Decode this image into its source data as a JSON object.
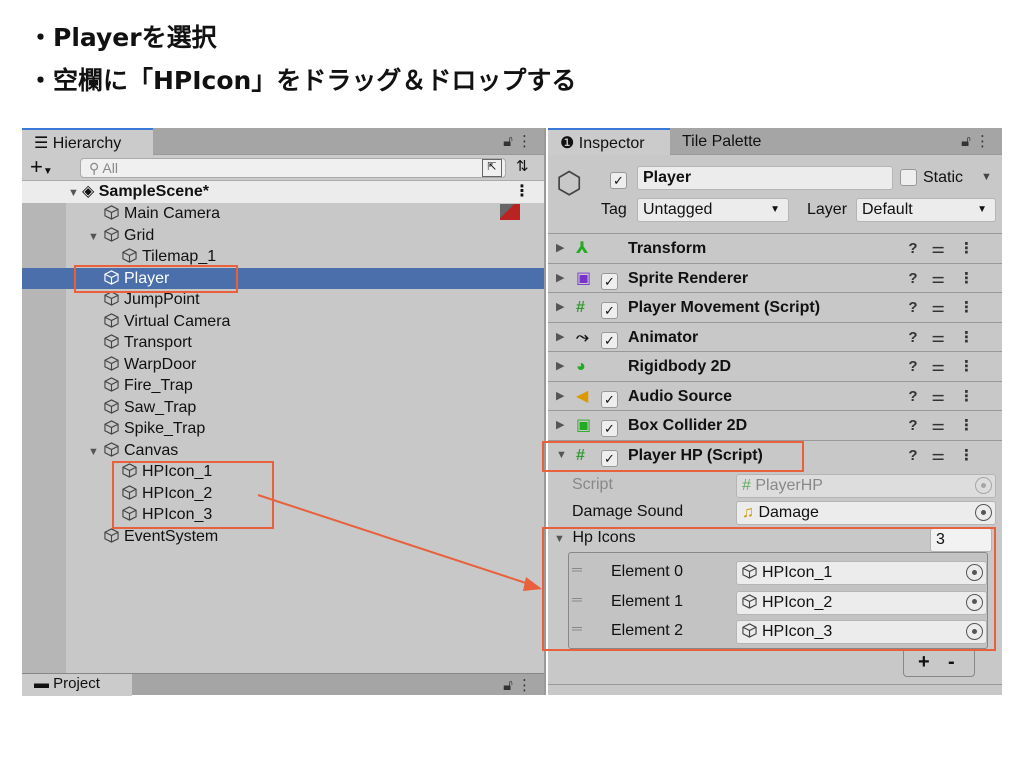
{
  "instructions": [
    "・Playerを選択",
    "・空欄に「HPIcon」をドラッグ＆ドロップする"
  ],
  "hierarchy": {
    "tab": "Hierarchy",
    "search_placeholder": "All",
    "scene": "SampleScene*",
    "items": [
      "Main Camera",
      "Grid",
      "Tilemap_1",
      "Player",
      "JumpPoint",
      "Virtual Camera",
      "Transport",
      "WarpDoor",
      "Fire_Trap",
      "Saw_Trap",
      "Spike_Trap",
      "Canvas",
      "HPIcon_1",
      "HPIcon_2",
      "HPIcon_3",
      "EventSystem"
    ],
    "selected": "Player"
  },
  "project_tab": "Project",
  "inspector": {
    "tabs": [
      "Inspector",
      "Tile Palette"
    ],
    "object_name": "Player",
    "static_label": "Static",
    "tag_label": "Tag",
    "tag_value": "Untagged",
    "layer_label": "Layer",
    "layer_value": "Default",
    "components": [
      "Transform",
      "Sprite Renderer",
      "Player Movement (Script)",
      "Animator",
      "Rigidbody 2D",
      "Audio Source",
      "Box Collider 2D",
      "Player HP (Script)"
    ],
    "script_label": "Script",
    "script_value": "PlayerHP",
    "damage_label": "Damage Sound",
    "damage_value": "Damage",
    "hp_icons_label": "Hp Icons",
    "hp_icons_size": "3",
    "elements": [
      {
        "label": "Element 0",
        "value": "HPIcon_1"
      },
      {
        "label": "Element 1",
        "value": "HPIcon_2"
      },
      {
        "label": "Element 2",
        "value": "HPIcon_3"
      }
    ],
    "add": "+",
    "remove": "-"
  },
  "colors": {
    "highlight": "#e8603c",
    "selection": "#4a6fab"
  }
}
